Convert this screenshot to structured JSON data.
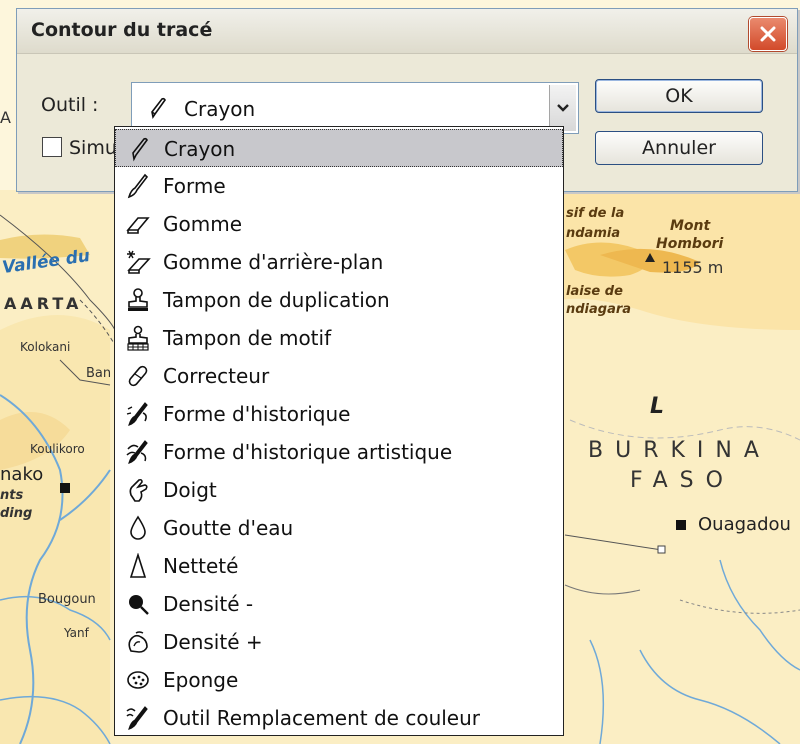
{
  "dialog": {
    "title": "Contour du tracé",
    "tool_label": "Outil :",
    "selected_tool": "Crayon",
    "simulate_label": "Simu",
    "ok_label": "OK",
    "cancel_label": "Annuler"
  },
  "dropdown": {
    "items": [
      {
        "label": "Crayon",
        "icon": "pencil-icon",
        "selected": true
      },
      {
        "label": "Forme",
        "icon": "brush-icon"
      },
      {
        "label": "Gomme",
        "icon": "eraser-icon"
      },
      {
        "label": "Gomme d'arrière-plan",
        "icon": "background-eraser-icon"
      },
      {
        "label": "Tampon de duplication",
        "icon": "clone-stamp-icon"
      },
      {
        "label": "Tampon de motif",
        "icon": "pattern-stamp-icon"
      },
      {
        "label": "Correcteur",
        "icon": "healing-brush-icon"
      },
      {
        "label": "Forme d'historique",
        "icon": "history-brush-icon"
      },
      {
        "label": "Forme d'historique artistique",
        "icon": "art-history-brush-icon"
      },
      {
        "label": "Doigt",
        "icon": "smudge-icon"
      },
      {
        "label": "Goutte d'eau",
        "icon": "blur-drop-icon"
      },
      {
        "label": "Netteté",
        "icon": "sharpen-icon"
      },
      {
        "label": "Densité -",
        "icon": "dodge-icon"
      },
      {
        "label": "Densité +",
        "icon": "burn-icon"
      },
      {
        "label": "Eponge",
        "icon": "sponge-icon"
      },
      {
        "label": "Outil Remplacement de couleur",
        "icon": "color-replacement-icon"
      }
    ]
  },
  "map": {
    "labels": {
      "vallee": "Vallée du",
      "kaarta": "AARTA",
      "kolokani": "Kolokani",
      "ban": "Ban",
      "koulikoro": "Koulikoro",
      "mako": "nako",
      "nts": "nts",
      "ding": "ding",
      "bougouni": "Bougoun",
      "yanfo": "Yanf",
      "massif1": "sif de la",
      "massif2": "ndamia",
      "falaise1": "laise de",
      "falaise2": "ndiagara",
      "mont1": "Mont",
      "mont2": "Hombori",
      "altitude": "1155 m",
      "letter_l": "L",
      "burkina": "BURKINA",
      "faso": "FASO",
      "ouaga": "Ouagadou",
      "left_a": "A"
    },
    "colors": {
      "land": "#fbeec4",
      "highland": "#f3c866",
      "river": "#6fa9d8",
      "border": "#444444"
    }
  }
}
